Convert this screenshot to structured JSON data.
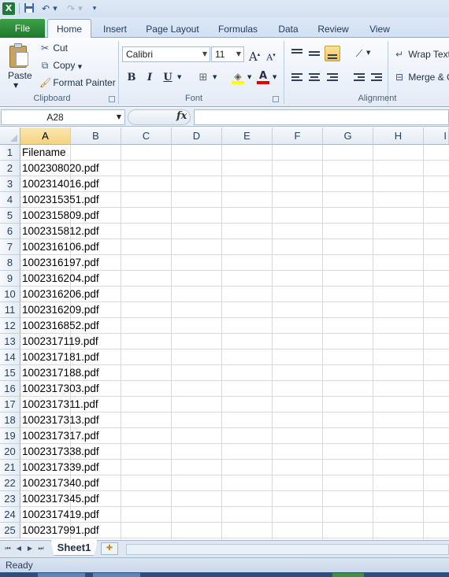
{
  "quick_access": {
    "app_icon": "excel-logo",
    "app_icon_letter": "X",
    "save_icon": "save-icon",
    "undo_icon": "undo-icon",
    "redo_icon": "redo-icon",
    "customize_icon": "customize-qat-icon"
  },
  "tabs": [
    "File",
    "Home",
    "Insert",
    "Page Layout",
    "Formulas",
    "Data",
    "Review",
    "View"
  ],
  "ribbon": {
    "clipboard": {
      "paste_label": "Paste",
      "cut_label": "Cut",
      "copy_label": "Copy",
      "format_painter_label": "Format Painter",
      "group_label": "Clipboard"
    },
    "font": {
      "font_name": "Calibri",
      "font_size": "11",
      "bold": "B",
      "italic": "I",
      "underline": "U",
      "grow": "A",
      "shrink": "A",
      "group_label": "Font",
      "fill_color": "#ffff00",
      "font_color": "#e00000"
    },
    "alignment": {
      "wrap_text_label": "Wrap Text",
      "merge_label": "Merge & C",
      "group_label": "Alignment"
    }
  },
  "formula_bar": {
    "name_box": "A28",
    "fx_label": "fx",
    "value": ""
  },
  "grid": {
    "columns": [
      "A",
      "B",
      "C",
      "D",
      "E",
      "F",
      "G",
      "H",
      "I"
    ],
    "selected_column": "A",
    "rows": [
      "1",
      "2",
      "3",
      "4",
      "5",
      "6",
      "7",
      "8",
      "9",
      "10",
      "11",
      "12",
      "13",
      "14",
      "15",
      "16",
      "17",
      "18",
      "19",
      "20",
      "21",
      "22",
      "23",
      "24",
      "25"
    ],
    "cells_A": [
      "Filename",
      "1002308020.pdf",
      "1002314016.pdf",
      "1002315351.pdf",
      "1002315809.pdf",
      "1002315812.pdf",
      "1002316106.pdf",
      "1002316197.pdf",
      "1002316204.pdf",
      "1002316206.pdf",
      "1002316209.pdf",
      "1002316852.pdf",
      "1002317119.pdf",
      "1002317181.pdf",
      "1002317188.pdf",
      "1002317303.pdf",
      "1002317311.pdf",
      "1002317313.pdf",
      "1002317317.pdf",
      "1002317338.pdf",
      "1002317339.pdf",
      "1002317340.pdf",
      "1002317345.pdf",
      "1002317419.pdf",
      "1002317991.pdf"
    ]
  },
  "sheets": {
    "active": "Sheet1"
  },
  "status": {
    "text": "Ready"
  }
}
